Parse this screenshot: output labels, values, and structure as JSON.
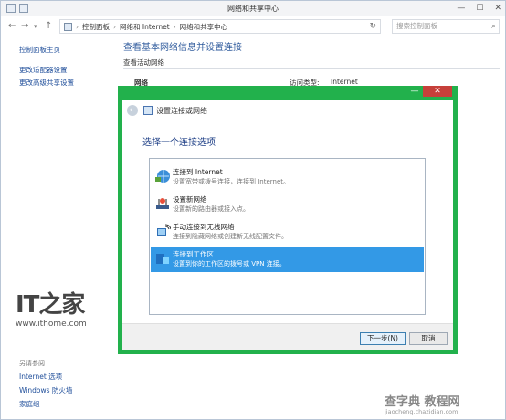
{
  "window": {
    "title": "网络和共享中心",
    "controls": [
      "—",
      "☐",
      "✕"
    ]
  },
  "address": {
    "crumbs": [
      "控制面板",
      "网络和 Internet",
      "网络和共享中心"
    ],
    "search_placeholder": "搜索控制面板"
  },
  "sidebar": {
    "home": "控制面板主页",
    "links": [
      "更改适配器设置",
      "更改高级共享设置"
    ],
    "see_also_heading": "另请参阅",
    "see_also": [
      "Internet 选项",
      "Windows 防火墙",
      "家庭组"
    ]
  },
  "main": {
    "title": "查看基本网络信息并设置连接",
    "active_networks_label": "查看活动网络",
    "network_name": "网络",
    "access_type_label": "访问类型:",
    "access_type_value": "Internet"
  },
  "watermark": {
    "logo": "IT之家",
    "url": "www.ithome.com",
    "site": "查字典 教程网",
    "site_url": "jiaocheng.chazidian.com"
  },
  "dialog": {
    "title": "设置连接或网络",
    "heading": "选择一个连接选项",
    "options": [
      {
        "title": "连接到 Internet",
        "desc": "设置宽带或拨号连接，连接到 Internet。"
      },
      {
        "title": "设置新网络",
        "desc": "设置新的路由器或接入点。"
      },
      {
        "title": "手动连接到无线网络",
        "desc": "连接到隐藏网络或创建新无线配置文件。"
      },
      {
        "title": "连接到工作区",
        "desc": "设置到你的工作区的拨号或 VPN 连接。"
      }
    ],
    "next_button": "下一步(N)",
    "cancel_button": "取消"
  }
}
